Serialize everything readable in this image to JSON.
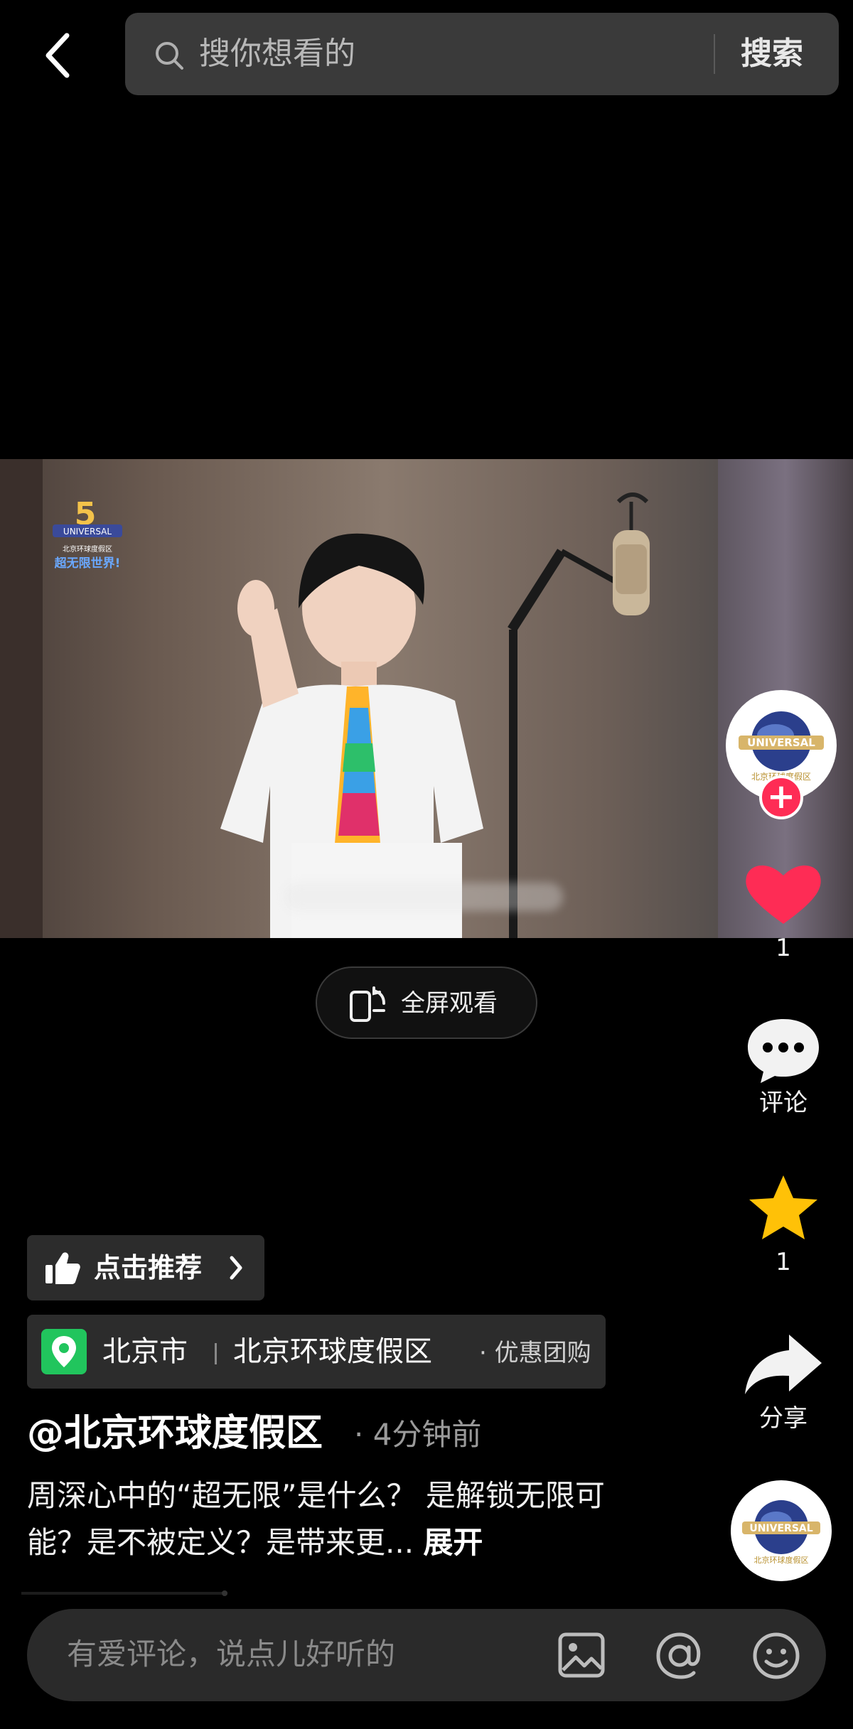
{
  "top_bar": {
    "search_placeholder": "搜你想看的",
    "search_button": "搜索"
  },
  "video": {
    "fullscreen_label": "全屏观看",
    "logo_text_top": "UNIVERSAL",
    "logo_text_bottom": "超无限世界!"
  },
  "actions": {
    "like_count": "1",
    "comment_label": "评论",
    "favorite_count": "1",
    "share_label": "分享",
    "avatar_text": "UNIVERSAL"
  },
  "post": {
    "recommend_label": "点击推荐",
    "location_city": "北京市",
    "location_place": "北京环球度假区",
    "location_deal": "· 优惠团购",
    "author": "@北京环球度假区",
    "time": "· 4分钟前",
    "caption": "周深心中的“超无限”是什么？ 是解锁无限可能？是不被定义？是带来更...",
    "expand": "展开"
  },
  "comment_bar": {
    "placeholder": "有爱评论，说点儿好听的"
  },
  "colors": {
    "like_red": "#fe2c55",
    "favorite_yellow": "#ffc107",
    "location_green": "#21c55d"
  }
}
